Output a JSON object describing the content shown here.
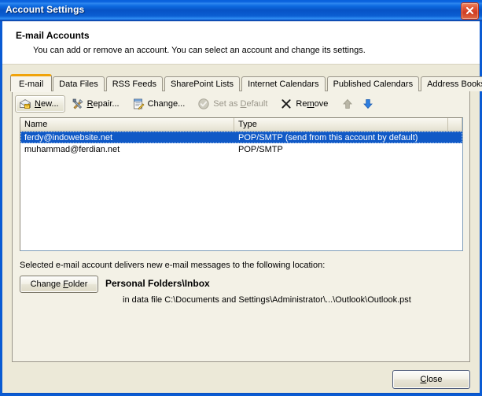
{
  "window": {
    "title": "Account Settings",
    "close_icon": "close-icon"
  },
  "header": {
    "title": "E-mail Accounts",
    "subtitle": "You can add or remove an account. You can select an account and change its settings."
  },
  "tabs": [
    {
      "label": "E-mail",
      "active": true
    },
    {
      "label": "Data Files",
      "active": false
    },
    {
      "label": "RSS Feeds",
      "active": false
    },
    {
      "label": "SharePoint Lists",
      "active": false
    },
    {
      "label": "Internet Calendars",
      "active": false
    },
    {
      "label": "Published Calendars",
      "active": false
    },
    {
      "label": "Address Books",
      "active": false
    }
  ],
  "toolbar": {
    "new": {
      "label": "New...",
      "accel": "N",
      "icon": "new-mail-icon",
      "enabled": true
    },
    "repair": {
      "label": "Repair...",
      "accel": "R",
      "icon": "repair-tools-icon",
      "enabled": true
    },
    "change": {
      "label": "Change...",
      "accel": "g",
      "icon": "change-properties-icon",
      "enabled": true
    },
    "set_default": {
      "label": "Set as Default",
      "accel": "D",
      "icon": "check-circle-icon",
      "enabled": false
    },
    "remove": {
      "label": "Remove",
      "accel": "m",
      "icon": "remove-x-icon",
      "enabled": true
    },
    "move_up": {
      "icon": "arrow-up-icon",
      "enabled": false
    },
    "move_down": {
      "icon": "arrow-down-icon",
      "enabled": true
    }
  },
  "accounts_list": {
    "columns": [
      "Name",
      "Type"
    ],
    "rows": [
      {
        "name": "ferdy@indowebsite.net",
        "type": "POP/SMTP (send from this account by default)",
        "selected": true
      },
      {
        "name": "muhammad@ferdian.net",
        "type": "POP/SMTP",
        "selected": false
      }
    ]
  },
  "delivery": {
    "label": "Selected e-mail account delivers new e-mail messages to the following location:",
    "change_folder_button": "Change Folder",
    "folder": "Personal Folders\\Inbox",
    "data_file": "in data file C:\\Documents and Settings\\Administrator\\...\\Outlook\\Outlook.pst"
  },
  "footer": {
    "close_button": "Close"
  },
  "colors": {
    "title_bar_blue": "#0a5bd3",
    "active_tab_accent": "#f0a30a",
    "selection_blue": "#1059c6",
    "dialog_face": "#ece9d8",
    "close_button_red": "#cf3c22"
  }
}
